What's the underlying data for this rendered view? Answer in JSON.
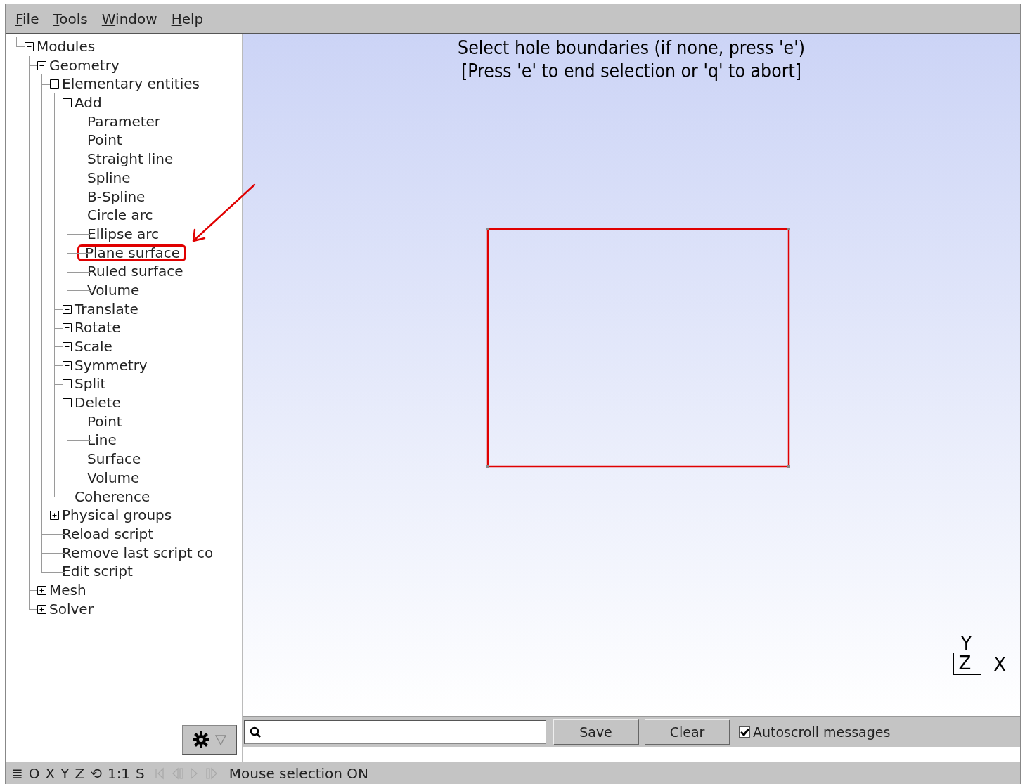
{
  "menu": [
    {
      "label": "File"
    },
    {
      "label": "Tools"
    },
    {
      "label": "Window"
    },
    {
      "label": "Help"
    }
  ],
  "tree": [
    {
      "label": "Modules",
      "expanded": true,
      "circled": false,
      "children": [
        {
          "label": "Geometry",
          "expanded": true,
          "circled": false,
          "children": [
            {
              "label": "Elementary entities",
              "expanded": true,
              "circled": false,
              "children": [
                {
                  "label": "Add",
                  "expanded": true,
                  "circled": false,
                  "children": [
                    {
                      "label": "Parameter",
                      "circled": false
                    },
                    {
                      "label": "Point",
                      "circled": false
                    },
                    {
                      "label": "Straight line",
                      "circled": false
                    },
                    {
                      "label": "Spline",
                      "circled": false
                    },
                    {
                      "label": "B-Spline",
                      "circled": false
                    },
                    {
                      "label": "Circle arc",
                      "circled": false
                    },
                    {
                      "label": "Ellipse arc",
                      "circled": false
                    },
                    {
                      "label": "Plane surface",
                      "circled": true
                    },
                    {
                      "label": "Ruled surface",
                      "circled": false
                    },
                    {
                      "label": "Volume",
                      "circled": false
                    }
                  ]
                },
                {
                  "label": "Translate",
                  "expanded": false,
                  "circled": false
                },
                {
                  "label": "Rotate",
                  "expanded": false,
                  "circled": false
                },
                {
                  "label": "Scale",
                  "expanded": false,
                  "circled": false
                },
                {
                  "label": "Symmetry",
                  "expanded": false,
                  "circled": false
                },
                {
                  "label": "Split",
                  "expanded": false,
                  "circled": false
                },
                {
                  "label": "Delete",
                  "expanded": true,
                  "circled": false,
                  "children": [
                    {
                      "label": "Point",
                      "circled": false
                    },
                    {
                      "label": "Line",
                      "circled": false
                    },
                    {
                      "label": "Surface",
                      "circled": false
                    },
                    {
                      "label": "Volume",
                      "circled": false
                    }
                  ]
                },
                {
                  "label": "Coherence",
                  "circled": false
                }
              ]
            },
            {
              "label": "Physical groups",
              "expanded": false,
              "circled": false
            },
            {
              "label": "Reload script",
              "circled": false
            },
            {
              "label": "Remove last script co",
              "circled": false
            },
            {
              "label": "Edit script",
              "circled": false
            }
          ]
        },
        {
          "label": "Mesh",
          "expanded": false,
          "circled": false
        },
        {
          "label": "Solver",
          "expanded": false,
          "circled": false
        }
      ]
    }
  ],
  "viewport": {
    "prompt_lines": [
      "Select hole boundaries (if none, press 'e')",
      "[Press 'e' to end selection or 'q' to abort]"
    ],
    "axes": {
      "y": "Y",
      "z": "Z",
      "x": "X"
    }
  },
  "messages": {
    "save": "Save",
    "clear": "Clear",
    "autoscroll": {
      "label": "Autoscroll messages",
      "checked": true
    }
  },
  "status_bar": {
    "buttons": [
      "≣",
      "O",
      "X",
      "Y",
      "Z",
      "⟲",
      "1:1",
      "S"
    ],
    "playback_disabled": true,
    "message": "Mouse selection ON"
  }
}
